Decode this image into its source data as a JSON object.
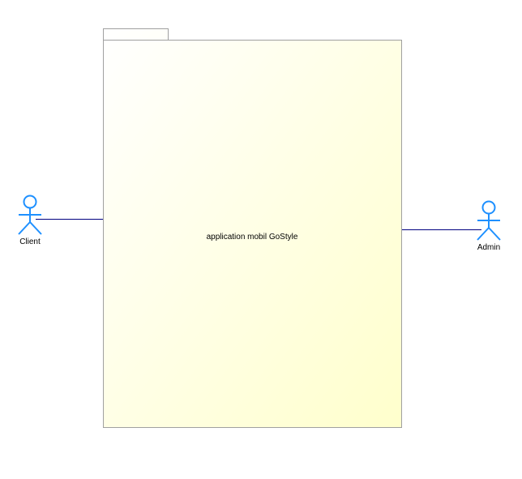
{
  "package": {
    "label": "application mobil GoStyle",
    "fill_start": "#ffffff",
    "fill_end": "#ffffcc",
    "border": "#a0a0a0"
  },
  "actors": {
    "client": {
      "label": "Client"
    },
    "admin": {
      "label": "Admin"
    }
  },
  "colors": {
    "actor_stroke": "#1e90ff",
    "association": "#000080"
  }
}
